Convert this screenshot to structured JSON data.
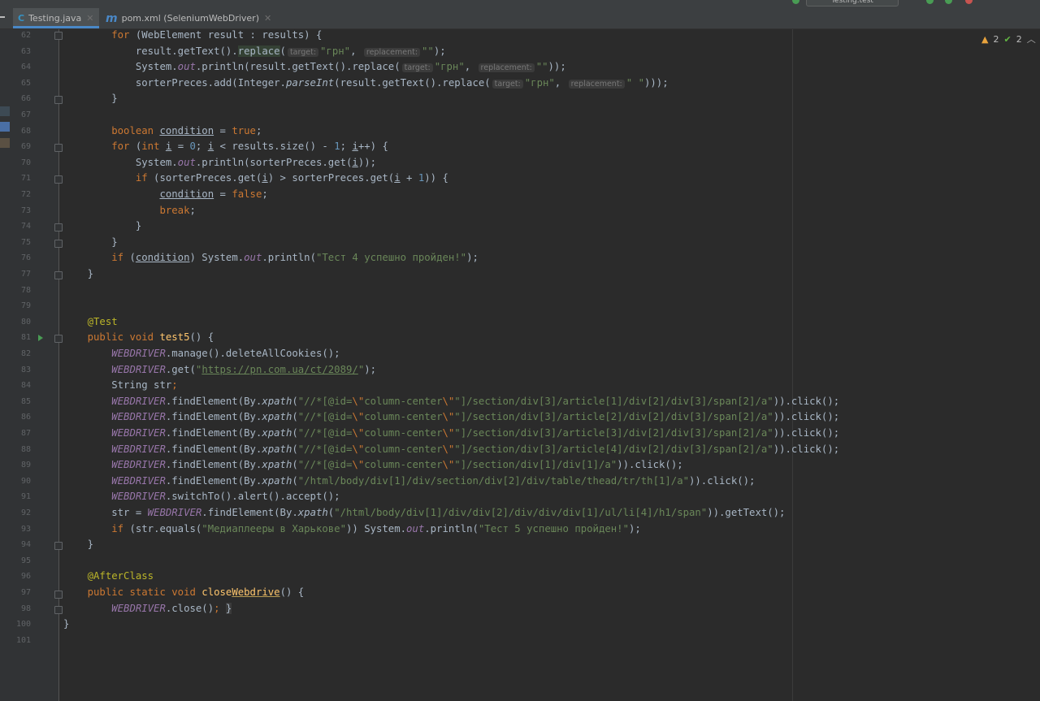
{
  "window": {
    "config_selector": "Testing.test"
  },
  "tabs": [
    {
      "label": "Testing.java",
      "icon": "C",
      "icon_color": "#3592c4",
      "active": true
    },
    {
      "label": "pom.xml (SeleniumWebDriver)",
      "icon": "m",
      "icon_color": "#4a88c7",
      "active": false
    }
  ],
  "inspections": {
    "warnings": "2",
    "ok": "2"
  },
  "editor": {
    "line_numbers": [
      "62",
      "63",
      "64",
      "65",
      "66",
      "67",
      "68",
      "69",
      "70",
      "71",
      "72",
      "73",
      "74",
      "75",
      "76",
      "77",
      "78",
      "79",
      "80",
      "81",
      "82",
      "83",
      "84",
      "85",
      "86",
      "87",
      "88",
      "89",
      "90",
      "91",
      "92",
      "93",
      "94",
      "95",
      "96",
      "97",
      "98",
      "100",
      "101"
    ],
    "hints": {
      "target": "target:",
      "replacement": "replacement:"
    },
    "strings": {
      "grn": "\"грн\"",
      "empty": "\"\"",
      "space": "\" \"",
      "test4": "\"Тест 4 успешно пройден!\"",
      "url": "https://pn.com.ua/ct/2089/",
      "xp_prefix": "\"//*[@id=",
      "xp_esc": "\\\"",
      "xp_cc": "column-center",
      "xp85": "\"]/section/div[3]/article[1]/div[2]/div[3]/span[2]/a\"",
      "xp86": "\"]/section/div[3]/article[2]/div[2]/div[3]/span[2]/a\"",
      "xp87": "\"]/section/div[3]/article[3]/div[2]/div[3]/span[2]/a\"",
      "xp88": "\"]/section/div[3]/article[4]/div[2]/div[3]/span[2]/a\"",
      "xp89": "\"]/section/div[1]/div[1]/a\"",
      "xp90": "\"/html/body/div[1]/div/section/div[2]/div/table/thead/tr/th[1]/a\"",
      "xp92": "\"/html/body/div[1]/div/div[2]/div/div/div[1]/ul/li[4]/h1/span\"",
      "media": "\"Медиаплееры в Харькове\"",
      "test5": "\"Тест 5 успешно пройден!\""
    }
  }
}
